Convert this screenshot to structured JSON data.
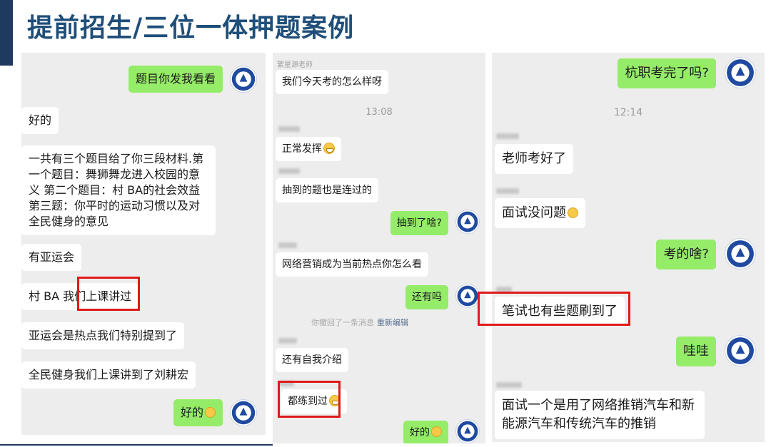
{
  "slide": {
    "title": "提前招生/三位一体押题案例"
  },
  "panel1": {
    "messages": [
      {
        "text": "题目你发我看看"
      },
      {
        "text": "好的"
      },
      {
        "text": "一共有三个题目给了你三段材料.第一个题目：舞狮舞龙进入校园的意义 第二个题目：村 BA的社会效益 第三题：你平时的运动习惯以及对全民健身的意见"
      },
      {
        "text": "有亚运会"
      },
      {
        "text": "村 BA 我们上课讲过"
      },
      {
        "text": "亚运会是热点我们特别提到了"
      },
      {
        "text": "全民健身我们上课讲到了刘耕宏"
      },
      {
        "text": "好的"
      }
    ]
  },
  "panel2": {
    "sender_top": "繁星源老师",
    "time": "13:08",
    "messages": [
      {
        "text": "我们今天考的怎么样呀"
      },
      {
        "text": "正常发挥"
      },
      {
        "text": "抽到的题也是连过的"
      },
      {
        "text": "抽到了啥?"
      },
      {
        "text": "网络营销成为当前热点你怎么看"
      },
      {
        "text": "还有吗"
      },
      {
        "text": "还有自我介绍"
      },
      {
        "text": "都练到过"
      },
      {
        "text": "好的"
      }
    ],
    "recall_note": "你撤回了一条消息",
    "recall_edit": "重新编辑"
  },
  "panel3": {
    "time": "12:14",
    "messages": [
      {
        "text": "杭职考完了吗?"
      },
      {
        "text": "老师考好了"
      },
      {
        "text": "面试没问题"
      },
      {
        "text": "考的啥?"
      },
      {
        "text": "笔试也有些题刷到了"
      },
      {
        "text": "哇哇"
      },
      {
        "text": "面试一个是用了网络推销汽车和新能源汽车和传统汽车的推销"
      }
    ]
  },
  "icons": {
    "avatar": "school-emblem-avatar",
    "ok_hand": "ok-hand-emoji",
    "grin": "grinning-face-emoji"
  },
  "colors": {
    "title": "#1f4e79",
    "bubble_sent": "#95ec69",
    "bubble_received": "#ffffff",
    "chat_background": "#ededed",
    "highlight": "#e01919"
  }
}
